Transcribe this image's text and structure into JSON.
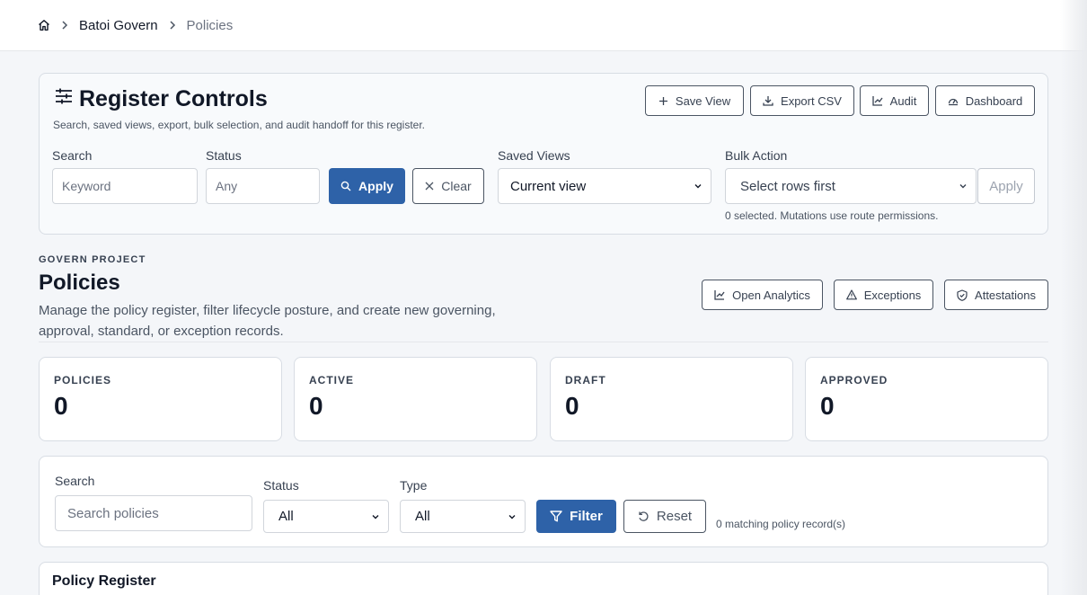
{
  "breadcrumb": {
    "items": [
      "Batoi Govern",
      "Policies"
    ]
  },
  "register_controls": {
    "title": "Register Controls",
    "subtitle": "Search, saved views, export, bulk selection, and audit handoff for this register.",
    "actions": {
      "save_view": "Save View",
      "export_csv": "Export CSV",
      "audit": "Audit",
      "dashboard": "Dashboard"
    },
    "search": {
      "label": "Search",
      "placeholder": "Keyword"
    },
    "status": {
      "label": "Status",
      "placeholder": "Any"
    },
    "apply_label": "Apply",
    "clear_label": "Clear",
    "saved_views": {
      "label": "Saved Views",
      "value": "Current view"
    },
    "bulk_action": {
      "label": "Bulk Action",
      "value": "Select rows first",
      "apply_label": "Apply",
      "note": "0 selected. Mutations use route permissions."
    }
  },
  "header": {
    "eyebrow": "GOVERN PROJECT",
    "title": "Policies",
    "description": "Manage the policy register, filter lifecycle posture, and create new governing, approval, standard, or exception records.",
    "actions": {
      "open_analytics": "Open Analytics",
      "exceptions": "Exceptions",
      "attestations": "Attestations"
    }
  },
  "kpis": [
    {
      "label": "POLICIES",
      "value": "0"
    },
    {
      "label": "ACTIVE",
      "value": "0"
    },
    {
      "label": "DRAFT",
      "value": "0"
    },
    {
      "label": "APPROVED",
      "value": "0"
    }
  ],
  "filters": {
    "search": {
      "label": "Search",
      "placeholder": "Search policies"
    },
    "status": {
      "label": "Status",
      "value": "All"
    },
    "type": {
      "label": "Type",
      "value": "All"
    },
    "filter_label": "Filter",
    "reset_label": "Reset",
    "match_count": "0 matching policy record(s)"
  },
  "register": {
    "title": "Policy Register"
  },
  "colors": {
    "primary": "#2e62a8",
    "border": "#d8dde4",
    "background": "#f4f6f9"
  }
}
